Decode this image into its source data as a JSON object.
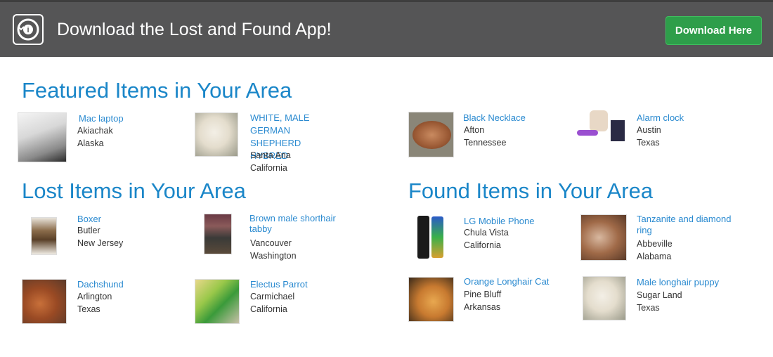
{
  "banner": {
    "title": "Download the Lost and Found App!",
    "button_label": "Download Here"
  },
  "featured": {
    "title": "Featured Items in Your Area",
    "items": [
      {
        "name": "Mac laptop",
        "city": "Akiachak",
        "state": "Alaska"
      },
      {
        "name": "WHITE, MALE GERMAN SHEPHERD HYBRED",
        "city": "Santa Ana",
        "state": "California"
      },
      {
        "name": "Black Necklace",
        "city": "Afton",
        "state": "Tennessee"
      },
      {
        "name": "Alarm clock",
        "city": "Austin",
        "state": "Texas"
      }
    ]
  },
  "lost": {
    "title": "Lost Items in Your Area",
    "items": [
      {
        "name": "Boxer",
        "city": "Butler",
        "state": "New Jersey"
      },
      {
        "name": "Brown male shorthair tabby",
        "city": "Vancouver",
        "state": "Washington"
      },
      {
        "name": "Dachshund",
        "city": "Arlington",
        "state": "Texas"
      },
      {
        "name": "Electus Parrot",
        "city": "Carmichael",
        "state": "California"
      }
    ]
  },
  "found": {
    "title": "Found Items in Your Area",
    "items": [
      {
        "name": "LG Mobile Phone",
        "city": "Chula Vista",
        "state": "California"
      },
      {
        "name": "Tanzanite and diamond ring",
        "city": "Abbeville",
        "state": "Alabama"
      },
      {
        "name": "Orange Longhair Cat",
        "city": "Pine Bluff",
        "state": "Arkansas"
      },
      {
        "name": "Male longhair puppy",
        "city": "Sugar Land",
        "state": "Texas"
      }
    ]
  }
}
